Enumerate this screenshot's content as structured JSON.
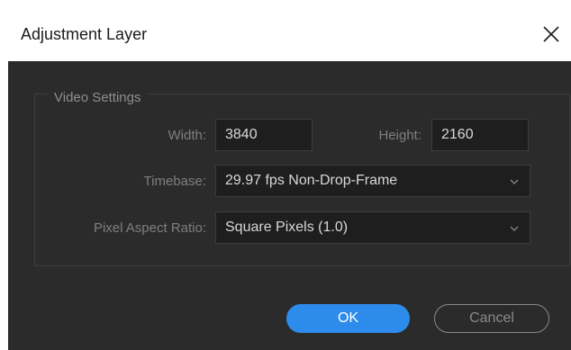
{
  "dialog": {
    "title": "Adjustment Layer",
    "close_icon": "close-icon"
  },
  "video_settings": {
    "legend": "Video Settings",
    "width_label": "Width:",
    "width_value": "3840",
    "height_label": "Height:",
    "height_value": "2160",
    "timebase_label": "Timebase:",
    "timebase_value": "29.97 fps Non-Drop-Frame",
    "par_label": "Pixel Aspect Ratio:",
    "par_value": "Square Pixels (1.0)"
  },
  "buttons": {
    "ok_label": "OK",
    "cancel_label": "Cancel"
  },
  "colors": {
    "dialog_bg": "#2b2b2b",
    "field_bg": "#1e1e1e",
    "accent": "#2d8ceb"
  }
}
